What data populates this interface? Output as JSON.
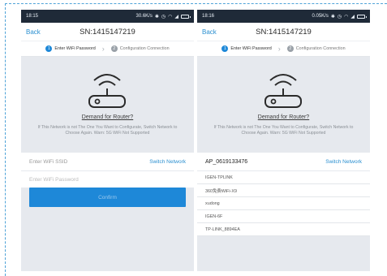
{
  "screens": [
    {
      "status": {
        "time": "18:15",
        "rate": "30.6K/s"
      },
      "nav": {
        "back_label": "Back",
        "title": "SN:1415147219"
      },
      "steps": {
        "step1_num": "1",
        "step1_label": "Enter WiFi Password",
        "step2_num": "2",
        "step2_label": "Configuration Connection"
      },
      "hero": {
        "demand_link": "Demand for Router?",
        "note": "If This Network is not The One You Want to Configurate, Switch Network to Choose Again. Warn: 5G WiFi Not Supported"
      },
      "ssid_field": {
        "placeholder": "Enter WiFi SSID",
        "switch_label": "Switch Network"
      },
      "password_field": {
        "placeholder": "Enter WiFi Password"
      },
      "confirm_label": "Confirm"
    },
    {
      "status": {
        "time": "18:16",
        "rate": "0.05K/s"
      },
      "nav": {
        "back_label": "Back",
        "title": "SN:1415147219"
      },
      "steps": {
        "step1_num": "1",
        "step1_label": "Enter WiFi Password",
        "step2_num": "2",
        "step2_label": "Configuration Connection"
      },
      "hero": {
        "demand_link": "Demand for Router?",
        "note": "If This Network is not The One You Want to Configurate, Switch Network to Choose Again. Warn: 5G WiFi Not Supported"
      },
      "ssid_field": {
        "value": "AP_0619133476",
        "switch_label": "Switch Network"
      },
      "networks": [
        "IGEN-TPLINK",
        "360免费WiFi-X9",
        "xudong",
        "IGEN-6F",
        "TP-LINK_8894EA"
      ]
    }
  ],
  "colors": {
    "accent": "#1e88d8",
    "link": "#2a8fd0",
    "status_bar": "#1f2a38",
    "background": "#e6e9ee"
  },
  "icons": {
    "router": "router-wifi-icon",
    "wifi": "wifi-icon",
    "signal": "signal-icon",
    "battery": "battery-icon",
    "bluetooth": "bluetooth-icon",
    "alarm": "alarm-icon"
  }
}
